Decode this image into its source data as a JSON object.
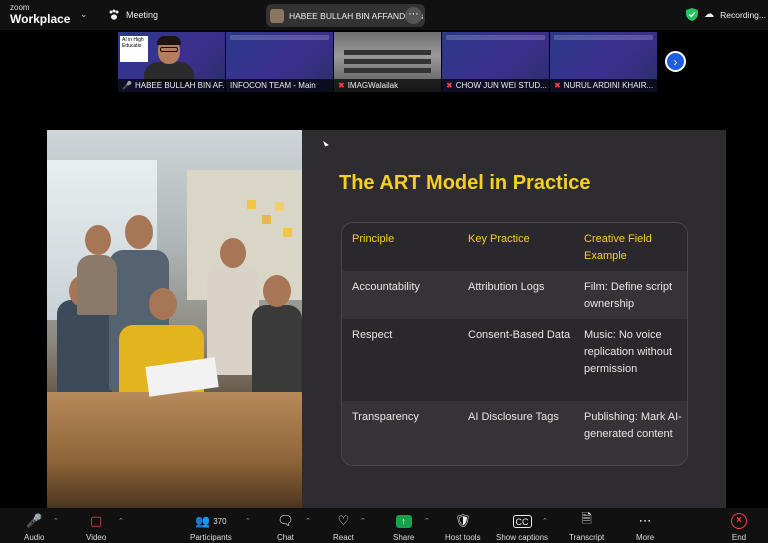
{
  "app": {
    "brand_small": "zoom",
    "brand_big": "Workplace",
    "meeting_label": "Meeting",
    "active_speaker": "HABEE BULLAH BIN AFFANDY's s",
    "recording_label": "Recording..."
  },
  "thumbnails": [
    {
      "name": "HABEE BULLAH BIN AF...",
      "muted": false,
      "active": true,
      "kind": "camera"
    },
    {
      "name": "INFOCON TEAM - Main",
      "muted": false,
      "active": false,
      "kind": "slide"
    },
    {
      "name": "IMAGWalailak",
      "muted": true,
      "active": false,
      "kind": "room"
    },
    {
      "name": "CHOW JUN WEI STUD...",
      "muted": true,
      "active": false,
      "kind": "slide"
    },
    {
      "name": "NURUL ARDINI KHAIR...",
      "muted": true,
      "active": false,
      "kind": "slide"
    }
  ],
  "thumb_card_text": "AI in High Educatio",
  "slide": {
    "title": "The ART Model in Practice",
    "table": {
      "headers": [
        "Principle",
        "Key Practice",
        "Creative Field Example"
      ],
      "rows": [
        [
          "Accountability",
          "Attribution Logs",
          "Film: Define script ownership"
        ],
        [
          "Respect",
          "Consent-Based Data",
          "Music: No voice replication without permission"
        ],
        [
          "Transparency",
          "AI Disclosure Tags",
          "Publishing: Mark AI-generated content"
        ]
      ]
    }
  },
  "toolbar": {
    "audio": "Audio",
    "video": "Video",
    "participants": "Participants",
    "participants_count": "370",
    "chat": "Chat",
    "react": "React",
    "share": "Share",
    "host_tools": "Host tools",
    "show_captions": "Show captions",
    "transcript": "Transcript",
    "more": "More",
    "end": "End"
  },
  "colors": {
    "accent_title": "#f5d020",
    "active_border": "#22c55e",
    "muted_red": "#ef4444",
    "share_green": "#16a34a",
    "next_blue": "#1e5de0"
  }
}
